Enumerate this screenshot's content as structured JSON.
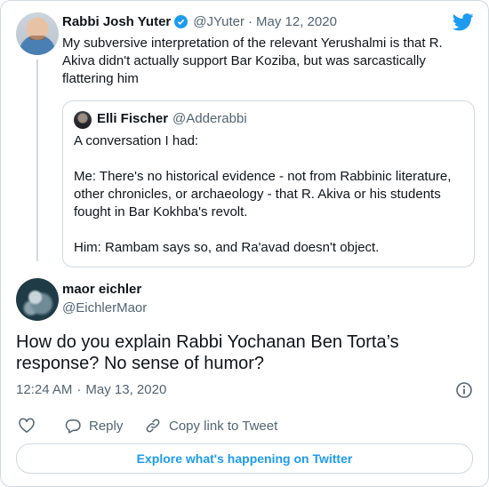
{
  "parent_tweet": {
    "author_name": "Rabbi Josh Yuter",
    "handle": "@JYuter",
    "separator": "·",
    "date": "May 12, 2020",
    "text_lines": [
      "My subversive interpretation of the relevant Yerushalmi is that R.",
      "Akiva didn't actually support Bar Koziba, but was sarcastically",
      "flattering him"
    ]
  },
  "quoted_tweet": {
    "author_name": "Elli Fischer",
    "handle": "@Adderabbi",
    "lines": [
      "A conversation I had:",
      "",
      "Me: There's no historical evidence - not from Rabbinic literature,",
      "other chronicles, or archaeology - that R. Akiva or his students",
      "fought in Bar Kokhba's revolt.",
      "",
      "Him: Rambam says so, and Ra'avad doesn't object."
    ]
  },
  "reply_tweet": {
    "author_name": "maor eichler",
    "handle": "@EichlerMaor",
    "text_lines": [
      "How do you explain Rabbi Yochanan Ben Torta’s",
      "response? No sense of humor?"
    ],
    "time": "12:24 AM",
    "separator": "·",
    "date": "May 13, 2020"
  },
  "actions": {
    "reply_label": "Reply",
    "copy_link_label": "Copy link to Tweet"
  },
  "explore_label": "Explore what's happening on Twitter",
  "colors": {
    "accent": "#1d9bf0",
    "text": "#0f1419",
    "secondary": "#536471",
    "border": "#cfd9de"
  },
  "icons": [
    "verified-badge-icon",
    "twitter-logo-icon",
    "info-icon",
    "heart-icon",
    "reply-icon",
    "link-icon"
  ]
}
